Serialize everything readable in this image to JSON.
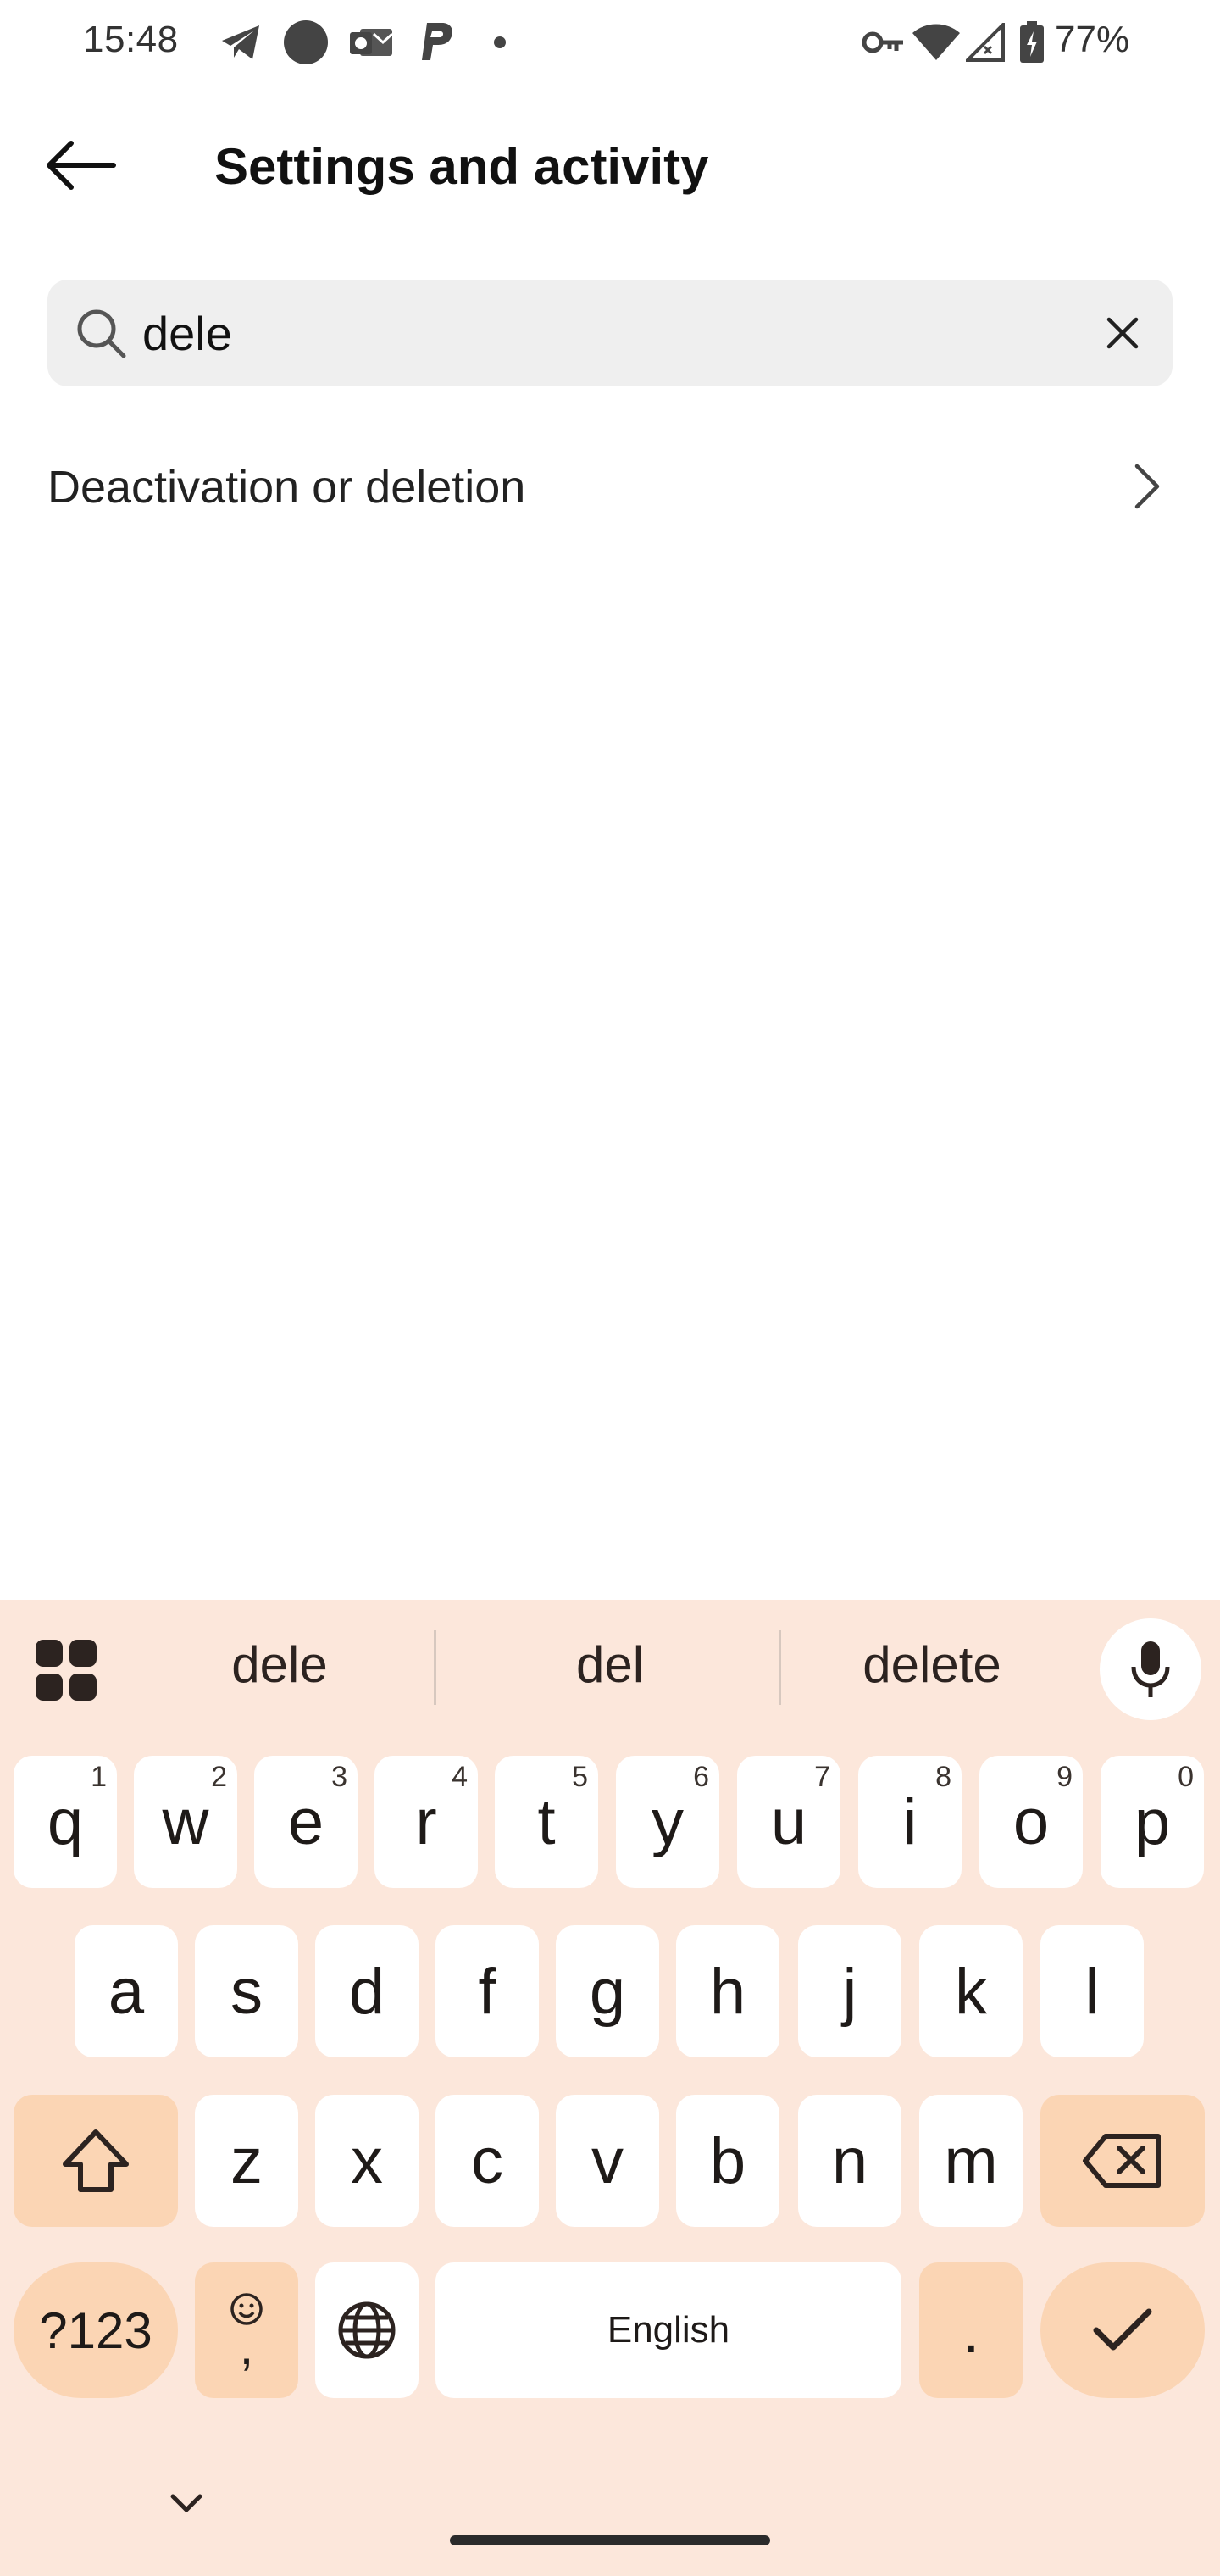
{
  "status_bar": {
    "time": "15:48",
    "battery": "77%",
    "icons": [
      "telegram-icon",
      "circle-icon",
      "outlook-icon",
      "paypal-icon",
      "dot-icon",
      "vpn-key-icon",
      "wifi-icon",
      "signal-icon",
      "battery-icon"
    ]
  },
  "header": {
    "title": "Settings and activity",
    "back_icon": "arrow-left-icon"
  },
  "search": {
    "value": "dele",
    "icon": "search-icon",
    "clear_icon": "close-icon"
  },
  "results": [
    {
      "label": "Deactivation or deletion",
      "icon": "chevron-right-icon"
    }
  ],
  "keyboard": {
    "suggestions": [
      "dele",
      "del",
      "delete"
    ],
    "row1": [
      {
        "key": "q",
        "hint": "1"
      },
      {
        "key": "w",
        "hint": "2"
      },
      {
        "key": "e",
        "hint": "3"
      },
      {
        "key": "r",
        "hint": "4"
      },
      {
        "key": "t",
        "hint": "5"
      },
      {
        "key": "y",
        "hint": "6"
      },
      {
        "key": "u",
        "hint": "7"
      },
      {
        "key": "i",
        "hint": "8"
      },
      {
        "key": "o",
        "hint": "9"
      },
      {
        "key": "p",
        "hint": "0"
      }
    ],
    "row2": [
      "a",
      "s",
      "d",
      "f",
      "g",
      "h",
      "j",
      "k",
      "l"
    ],
    "row3": [
      "z",
      "x",
      "c",
      "v",
      "b",
      "n",
      "m"
    ],
    "symbols_label": "?123",
    "comma_label": ",",
    "space_label": "English",
    "period_label": ".",
    "colors": {
      "background": "#fce7db",
      "key": "#ffffff",
      "special_key": "#fbd5b4"
    }
  }
}
